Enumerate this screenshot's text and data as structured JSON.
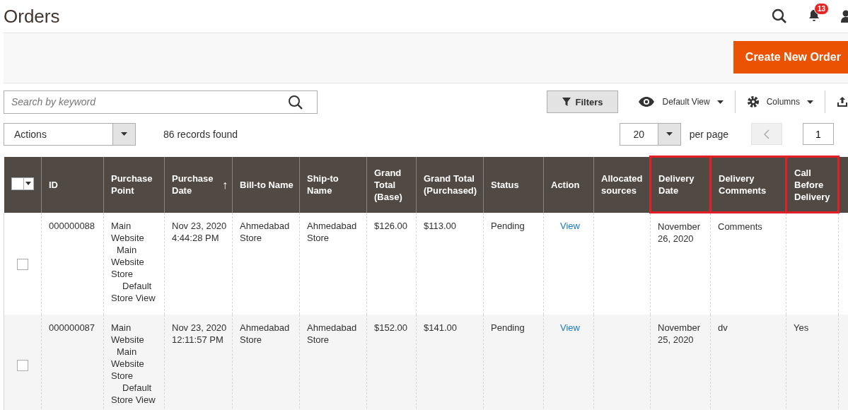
{
  "page_title": "Orders",
  "header": {
    "notifications": "13"
  },
  "actions_bar": {
    "primary_button": "Create New Order"
  },
  "toolbar": {
    "search": {
      "placeholder": "Search by keyword"
    },
    "filters": "Filters",
    "view": "Default View",
    "columns": "Columns"
  },
  "grid_controls": {
    "mass_action": "Actions",
    "records": "86 records found",
    "page_size": "20",
    "per_page": "per page",
    "page": "1"
  },
  "table": {
    "columns": [
      {
        "label": "ID",
        "highlighted": false
      },
      {
        "label": "Purchase Point",
        "highlighted": false
      },
      {
        "label": "Purchase Date",
        "sort_icon": "↑",
        "highlighted": false
      },
      {
        "label": "Bill-to Name",
        "highlighted": false
      },
      {
        "label": "Ship-to Name",
        "highlighted": false
      },
      {
        "label": "Grand Total (Base)",
        "highlighted": false
      },
      {
        "label": "Grand Total (Purchased)",
        "highlighted": false
      },
      {
        "label": "Status",
        "highlighted": false
      },
      {
        "label": "Action",
        "highlighted": false
      },
      {
        "label": "Allocated sources",
        "highlighted": false
      },
      {
        "label": "Delivery Date",
        "highlighted": true
      },
      {
        "label": "Delivery Comments",
        "highlighted": true
      },
      {
        "label": "Call Before Delivery",
        "highlighted": true
      }
    ],
    "rows": [
      {
        "checked": false,
        "id": "000000088",
        "purchase_point": [
          "Main Website",
          "Main Website Store",
          "Default Store View"
        ],
        "purchase_date": "Nov 23, 2020 4:44:28 PM",
        "bill_to": "Ahmedabad Store",
        "ship_to": "Ahmedabad Store",
        "total_base": "$126.00",
        "total_purchased": "$113.00",
        "status": "Pending",
        "action": "View",
        "delivery_date": "November 26, 2020",
        "delivery_comments": "Comments"
      },
      {
        "checked": false,
        "id": "000000087",
        "purchase_point": [
          "Main Website",
          "Main Website Store",
          "Default Store View"
        ],
        "purchase_date": "Nov 23, 2020 12:11:57 PM",
        "bill_to": "Ahmedabad Store",
        "ship_to": "Ahmedabad Store",
        "total_base": "$152.00",
        "total_purchased": "$141.00",
        "status": "Pending",
        "action": "View",
        "delivery_date": "November 25, 2020",
        "delivery_comments": "dv",
        "call_before": "Yes"
      }
    ]
  }
}
